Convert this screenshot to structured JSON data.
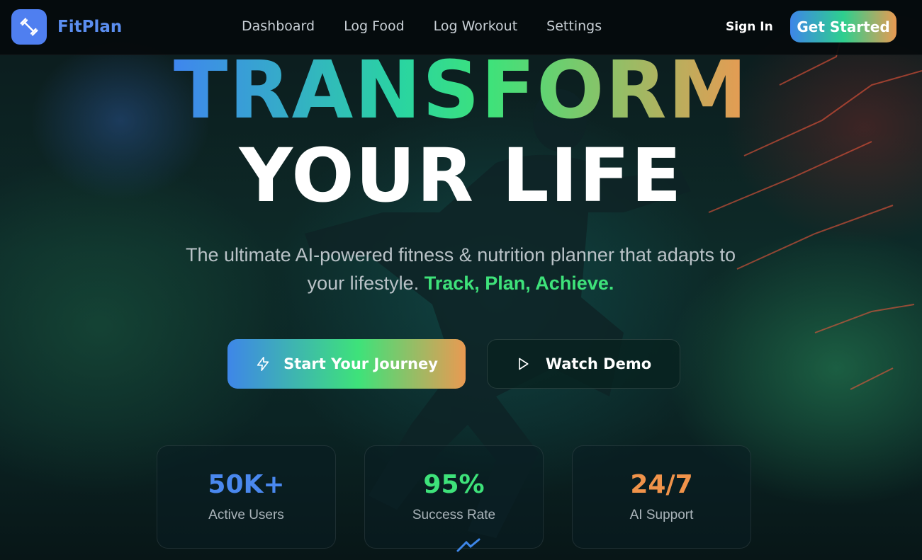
{
  "header": {
    "brand": "FitPlan",
    "nav": [
      "Dashboard",
      "Log Food",
      "Log Workout",
      "Settings"
    ],
    "sign_in": "Sign In",
    "get_started": "Get Started",
    "logo_icon": "dumbbell-icon"
  },
  "hero": {
    "headline_line1": "TRANSFORM",
    "headline_line2": "YOUR LIFE",
    "subtitle_main": "The ultimate AI-powered fitness & nutrition planner that adapts to your lifestyle.",
    "subtitle_accent": "Track, Plan, Achieve.",
    "primary_button": {
      "label": "Start Your Journey",
      "icon": "lightning-icon"
    },
    "secondary_button": {
      "label": "Watch Demo",
      "icon": "play-icon"
    }
  },
  "stats": [
    {
      "value": "50K+",
      "label": "Active Users",
      "color": "#4a88ee"
    },
    {
      "value": "95%",
      "label": "Success Rate",
      "color": "#3ee27a"
    },
    {
      "value": "24/7",
      "label": "AI Support",
      "color": "#f0934a"
    }
  ],
  "colors": {
    "accent_blue": "#4f7ff0",
    "accent_green": "#3ee27a",
    "accent_orange": "#e99a52"
  }
}
